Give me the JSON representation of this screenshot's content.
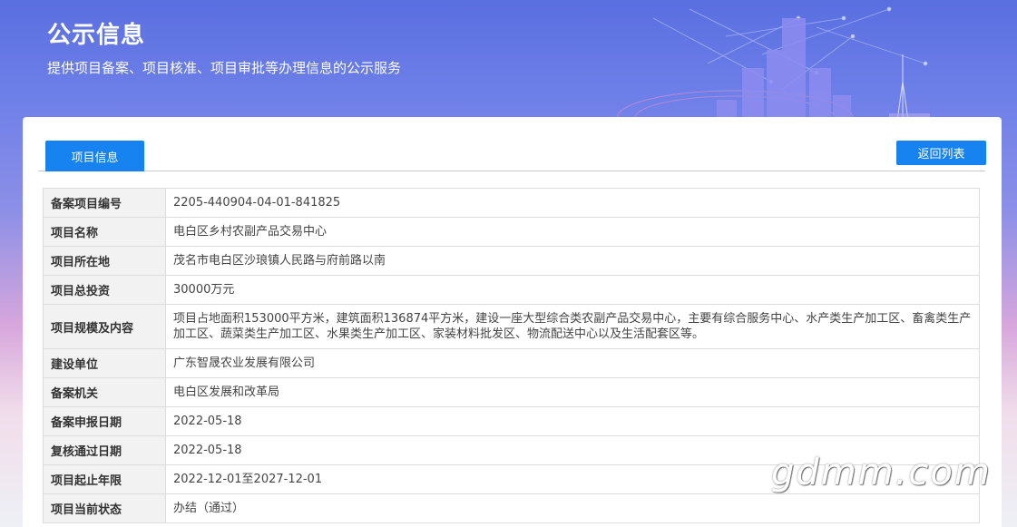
{
  "header": {
    "title": "公示信息",
    "subtitle": "提供项目备案、项目核准、项目审批等办理信息的公示服务"
  },
  "tabs": [
    {
      "label": "项目信息",
      "active": true
    }
  ],
  "back_button": {
    "label": "返回列表"
  },
  "rows": [
    {
      "label": "备案项目编号",
      "value": "2205-440904-04-01-841825"
    },
    {
      "label": "项目名称",
      "value": "电白区乡村农副产品交易中心"
    },
    {
      "label": "项目所在地",
      "value": "茂名市电白区沙琅镇人民路与府前路以南"
    },
    {
      "label": "项目总投资",
      "value": "30000万元"
    },
    {
      "label": "项目规模及内容",
      "value": "项目占地面积153000平方米，建筑面积136874平方米，建设一座大型综合类农副产品交易中心，主要有综合服务中心、水产类生产加工区、畜禽类生产加工区、蔬菜类生产加工区、水果类生产加工区、家装材料批发区、物流配送中心以及生活配套区等。"
    },
    {
      "label": "建设单位",
      "value": "广东智晟农业发展有限公司"
    },
    {
      "label": "备案机关",
      "value": "电白区发展和改革局"
    },
    {
      "label": "备案申报日期",
      "value": "2022-05-18"
    },
    {
      "label": "复核通过日期",
      "value": "2022-05-18"
    },
    {
      "label": "项目起止年限",
      "value": "2022-12-01至2027-12-01"
    },
    {
      "label": "项目当前状态",
      "value": "办结（通过）"
    }
  ],
  "watermark": "gdmm.com",
  "colors": {
    "accent": "#1683f0",
    "label_bg": "#f2f2f2",
    "border": "#dcdcdc"
  }
}
